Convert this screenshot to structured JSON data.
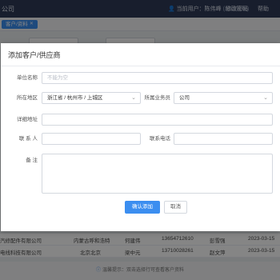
{
  "app": {
    "brand": "公司",
    "user_prefix": "当前用户：",
    "user_name": "陈伟峰",
    "user_dim": "(超级管理)",
    "links": [
      "修改密码",
      "帮助"
    ]
  },
  "tabs": [
    {
      "label": "客户/资料",
      "closable": true
    }
  ],
  "background_rows": [
    {
      "company": "汽修配件有限公司",
      "region": "内蒙古呼和浩特",
      "contact": "何建伟",
      "phone": "13654712610",
      "owner": "彭雪强",
      "date": "2023-03-15"
    },
    {
      "company": "电线科技有限公司",
      "region": "北京北京",
      "contact": "梁中元",
      "phone": "13710028261",
      "owner": "赵文萍",
      "date": "2023-03-15"
    }
  ],
  "footer_text": "温馨提示：双击选择行可查看客户资料",
  "dialog": {
    "title": "添加客户/供应商",
    "fields": {
      "unit_name": {
        "label": "单位名称",
        "placeholder": "不能为空",
        "value": ""
      },
      "region": {
        "label": "所在地区",
        "value": "浙江省 / 杭州市 / 上城区"
      },
      "salesperson": {
        "label": "所属业务员",
        "value": "公司"
      },
      "address": {
        "label": "详细地址",
        "value": ""
      },
      "contact": {
        "label": "联 系 人",
        "value": ""
      },
      "phone": {
        "label": "联系电话",
        "value": ""
      },
      "remark": {
        "label": "备 注",
        "value": ""
      }
    },
    "confirm_label": "确认添加",
    "cancel_label": "取消"
  },
  "colors": {
    "primary": "#3b8ef0",
    "topbar": "#2e3a57"
  }
}
